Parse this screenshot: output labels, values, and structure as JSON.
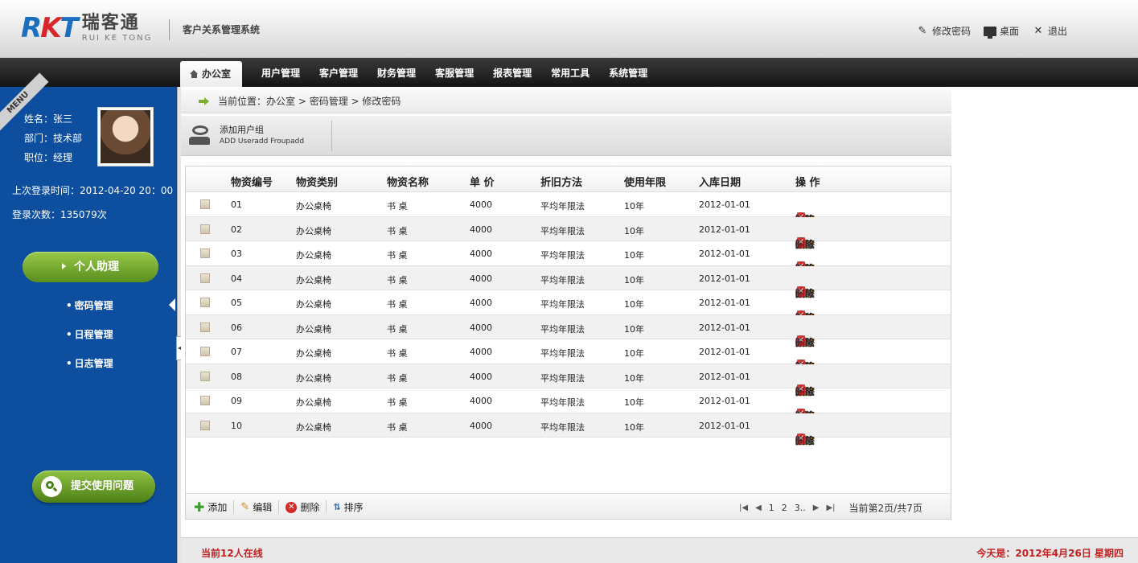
{
  "header": {
    "logo_mark_f": "R",
    "logo_mark_k": "K",
    "logo_mark_t": "T",
    "logo_cn": "瑞客通",
    "logo_en": "RUI KE TONG",
    "system_title": "客户关系管理系统",
    "links": {
      "change_password": "修改密码",
      "desktop": "桌面",
      "logout": "退出"
    }
  },
  "nav": {
    "items": [
      "办公室",
      "用户管理",
      "客户管理",
      "财务管理",
      "客服管理",
      "报表管理",
      "常用工具",
      "系统管理"
    ]
  },
  "sidebar": {
    "menu_ribbon": "MENU",
    "name": "姓名：张三",
    "dept": "部门：技术部",
    "position": "职位：经理",
    "last_login": "上次登录时间：2012-04-20 20：00",
    "login_count": "登录次数：135079次",
    "assist_label": "个人助理",
    "menu": [
      "密码管理",
      "日程管理",
      "日志管理"
    ],
    "help_label": "提交使用问题"
  },
  "breadcrumb": {
    "prefix": "当前位置：",
    "path": "办公室 > 密码管理 > 修改密码"
  },
  "toolbar": {
    "add_group_cn": "添加用户组",
    "add_group_en": "ADD Useradd Froupadd"
  },
  "table": {
    "headers": [
      "物资编号",
      "物资类别",
      "物资名称",
      "单  价",
      "折旧方法",
      "使用年限",
      "入库日期",
      "操  作"
    ],
    "rows": [
      {
        "id": "01",
        "category": "办公桌椅",
        "name": "书  桌",
        "price": "4000",
        "method": "平均年限法",
        "years": "10年",
        "date": "2012-01-01"
      },
      {
        "id": "02",
        "category": "办公桌椅",
        "name": "书  桌",
        "price": "4000",
        "method": "平均年限法",
        "years": "10年",
        "date": "2012-01-01"
      },
      {
        "id": "03",
        "category": "办公桌椅",
        "name": "书  桌",
        "price": "4000",
        "method": "平均年限法",
        "years": "10年",
        "date": "2012-01-01"
      },
      {
        "id": "04",
        "category": "办公桌椅",
        "name": "书  桌",
        "price": "4000",
        "method": "平均年限法",
        "years": "10年",
        "date": "2012-01-01"
      },
      {
        "id": "05",
        "category": "办公桌椅",
        "name": "书  桌",
        "price": "4000",
        "method": "平均年限法",
        "years": "10年",
        "date": "2012-01-01"
      },
      {
        "id": "06",
        "category": "办公桌椅",
        "name": "书  桌",
        "price": "4000",
        "method": "平均年限法",
        "years": "10年",
        "date": "2012-01-01"
      },
      {
        "id": "07",
        "category": "办公桌椅",
        "name": "书  桌",
        "price": "4000",
        "method": "平均年限法",
        "years": "10年",
        "date": "2012-01-01"
      },
      {
        "id": "08",
        "category": "办公桌椅",
        "name": "书  桌",
        "price": "4000",
        "method": "平均年限法",
        "years": "10年",
        "date": "2012-01-01"
      },
      {
        "id": "09",
        "category": "办公桌椅",
        "name": "书  桌",
        "price": "4000",
        "method": "平均年限法",
        "years": "10年",
        "date": "2012-01-01"
      },
      {
        "id": "10",
        "category": "办公桌椅",
        "name": "书  桌",
        "price": "4000",
        "method": "平均年限法",
        "years": "10年",
        "date": "2012-01-01"
      }
    ],
    "ops": [
      "发放",
      "维修",
      "报废",
      "删除"
    ]
  },
  "grid_footer": {
    "add": "添加",
    "edit": "编辑",
    "delete": "删除",
    "sort": "排序",
    "pages": [
      "1",
      "2",
      "3.."
    ],
    "page_status": "当前第2页/共7页"
  },
  "footer": {
    "online": "当前12人在线",
    "today": "今天是：2012年4月26日 星期四"
  },
  "colors": {
    "sidebar_bg": "#0d4f9e",
    "accent_green": "#6fa22a",
    "alert_red": "#c21f1f",
    "issue_orange": "#e07b00"
  }
}
